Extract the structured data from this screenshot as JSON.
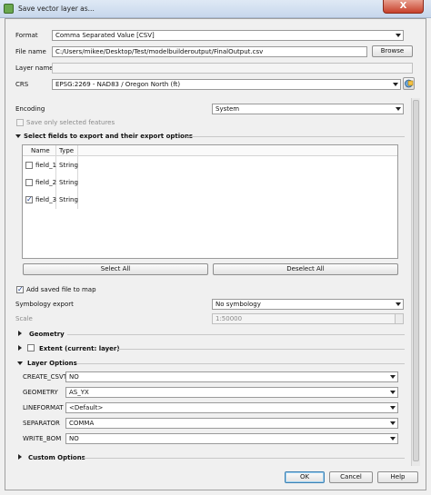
{
  "window": {
    "title": "Save vector layer as...",
    "close_label": "X"
  },
  "form": {
    "format_label": "Format",
    "format_value": "Comma Separated Value [CSV]",
    "filename_label": "File name",
    "filename_value": "C:/Users/mikee/Desktop/Test/modelbuilderoutput/FinalOutput.csv",
    "browse_label": "Browse",
    "layername_label": "Layer name",
    "layername_value": "",
    "crs_label": "CRS",
    "crs_value": "EPSG:2269 - NAD83 / Oregon North (ft)",
    "encoding_label": "Encoding",
    "encoding_value": "System",
    "save_selected_label": "Save only selected features"
  },
  "fields_section": {
    "title": "Select fields to export and their export options",
    "col_name": "Name",
    "col_type": "Type",
    "rows": [
      {
        "name": "field_1",
        "type": "String",
        "checked": false
      },
      {
        "name": "field_2",
        "type": "String",
        "checked": false
      },
      {
        "name": "field_3",
        "type": "String",
        "checked": true
      }
    ],
    "select_all_label": "Select All",
    "deselect_all_label": "Deselect All"
  },
  "add_to_map_label": "Add saved file to map",
  "symbology": {
    "label": "Symbology export",
    "value": "No symbology"
  },
  "scale": {
    "label": "Scale",
    "value": "1:50000"
  },
  "geometry_label": "Geometry",
  "extent_label": "Extent (current: layer)",
  "layer_options": {
    "title": "Layer Options",
    "items": [
      {
        "label": "CREATE_CSVT",
        "value": "NO"
      },
      {
        "label": "GEOMETRY",
        "value": "AS_YX"
      },
      {
        "label": "LINEFORMAT",
        "value": "<Default>"
      },
      {
        "label": "SEPARATOR",
        "value": "COMMA"
      },
      {
        "label": "WRITE_BOM",
        "value": "NO"
      }
    ]
  },
  "custom_options_label": "Custom Options",
  "buttons": {
    "ok": "OK",
    "cancel": "Cancel",
    "help": "Help"
  }
}
